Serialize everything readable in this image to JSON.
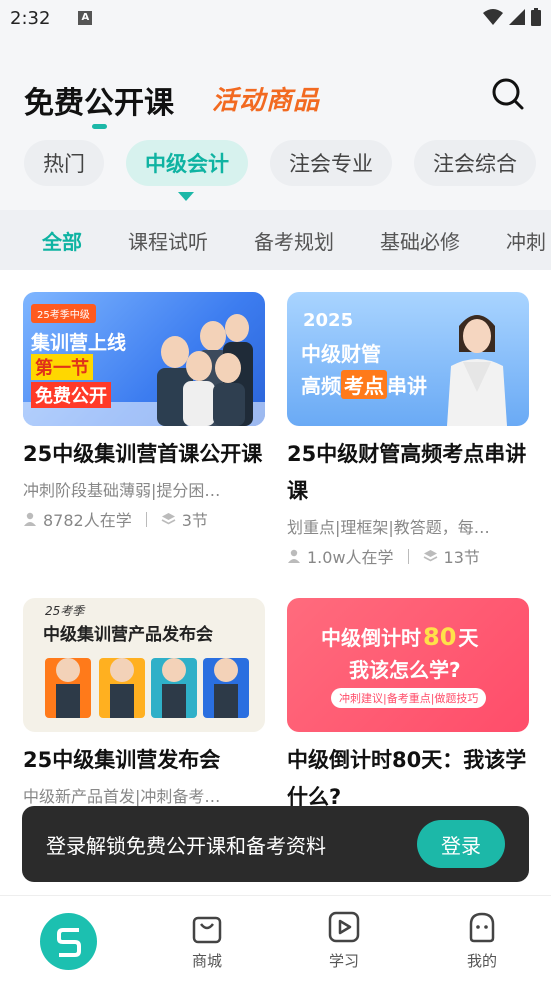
{
  "status_bar": {
    "time": "2:32"
  },
  "header": {
    "title": "免费公开课",
    "promo": "活动商品"
  },
  "category_chips": [
    {
      "label": "热门",
      "active": false
    },
    {
      "label": "中级会计",
      "active": true
    },
    {
      "label": "注会专业",
      "active": false
    },
    {
      "label": "注会综合",
      "active": false
    }
  ],
  "subtabs": [
    {
      "label": "全部",
      "active": true
    },
    {
      "label": "课程试听",
      "active": false
    },
    {
      "label": "备考规划",
      "active": false
    },
    {
      "label": "基础必修",
      "active": false
    },
    {
      "label": "冲刺",
      "active": false
    }
  ],
  "courses": [
    {
      "title": "25中级集训营首课公开课",
      "desc": "冲刺阶段基础薄弱|提分困…",
      "learners": "8782人在学",
      "lessons": "3节",
      "thumb": {
        "tag": "25考季中级",
        "line1": "集训营上线",
        "line2": "第一节",
        "line3": "免费公开"
      }
    },
    {
      "title": "25中级财管高频考点串讲课",
      "desc": "划重点|理框架|教答题，每…",
      "learners": "1.0w人在学",
      "lessons": "13节",
      "thumb": {
        "year": "2025",
        "line1": "中级财管",
        "line2a": "高频",
        "line2b": "考点",
        "line2c": "串讲"
      }
    },
    {
      "title": "25中级集训营发布会",
      "desc": "中级新产品首发|冲刺备考…",
      "learners": "",
      "lessons": "",
      "thumb": {
        "tag": "25考季",
        "line1": "中级集训营产品发布会"
      }
    },
    {
      "title": "中级倒计时80天：我该学什么?",
      "desc": "",
      "learners": "",
      "lessons": "",
      "thumb": {
        "line1": "中级倒计时",
        "days": "80",
        "unit": "天",
        "line2": "我该怎么学?",
        "tags": "冲刺建议|备考重点|做题技巧"
      }
    }
  ],
  "toast": {
    "text": "登录解锁免费公开课和备考资料",
    "button": "登录"
  },
  "bottom_nav": [
    {
      "label": "",
      "icon": "home-logo-icon",
      "active": true
    },
    {
      "label": "商城",
      "icon": "shopping-bag-icon",
      "active": false
    },
    {
      "label": "学习",
      "icon": "play-icon",
      "active": false
    },
    {
      "label": "我的",
      "icon": "profile-icon",
      "active": false
    }
  ],
  "colors": {
    "accent": "#1cb8a8",
    "promo": "#f26a21",
    "toast_bg": "#2b2b2b"
  }
}
